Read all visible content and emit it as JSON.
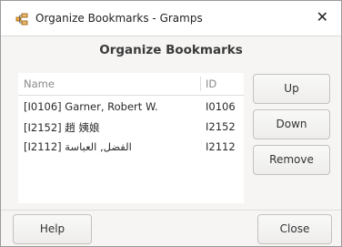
{
  "window": {
    "title": "Organize Bookmarks - Gramps",
    "close_glyph": "✕"
  },
  "dialog": {
    "heading": "Organize Bookmarks"
  },
  "list": {
    "columns": {
      "name": "Name",
      "id": "ID"
    },
    "rows": [
      {
        "name": "[I0106] Garner, Robert W.",
        "id": "I0106"
      },
      {
        "name": "[I2152] 趙 姨娘",
        "id": "I2152"
      },
      {
        "name": "[I2112] الفضل, العباسة",
        "id": "I2112"
      }
    ]
  },
  "buttons": {
    "up": "Up",
    "down": "Down",
    "remove": "Remove",
    "help": "Help",
    "close": "Close"
  },
  "icons": {
    "app": "gramps-tree-icon",
    "close": "close-icon"
  }
}
